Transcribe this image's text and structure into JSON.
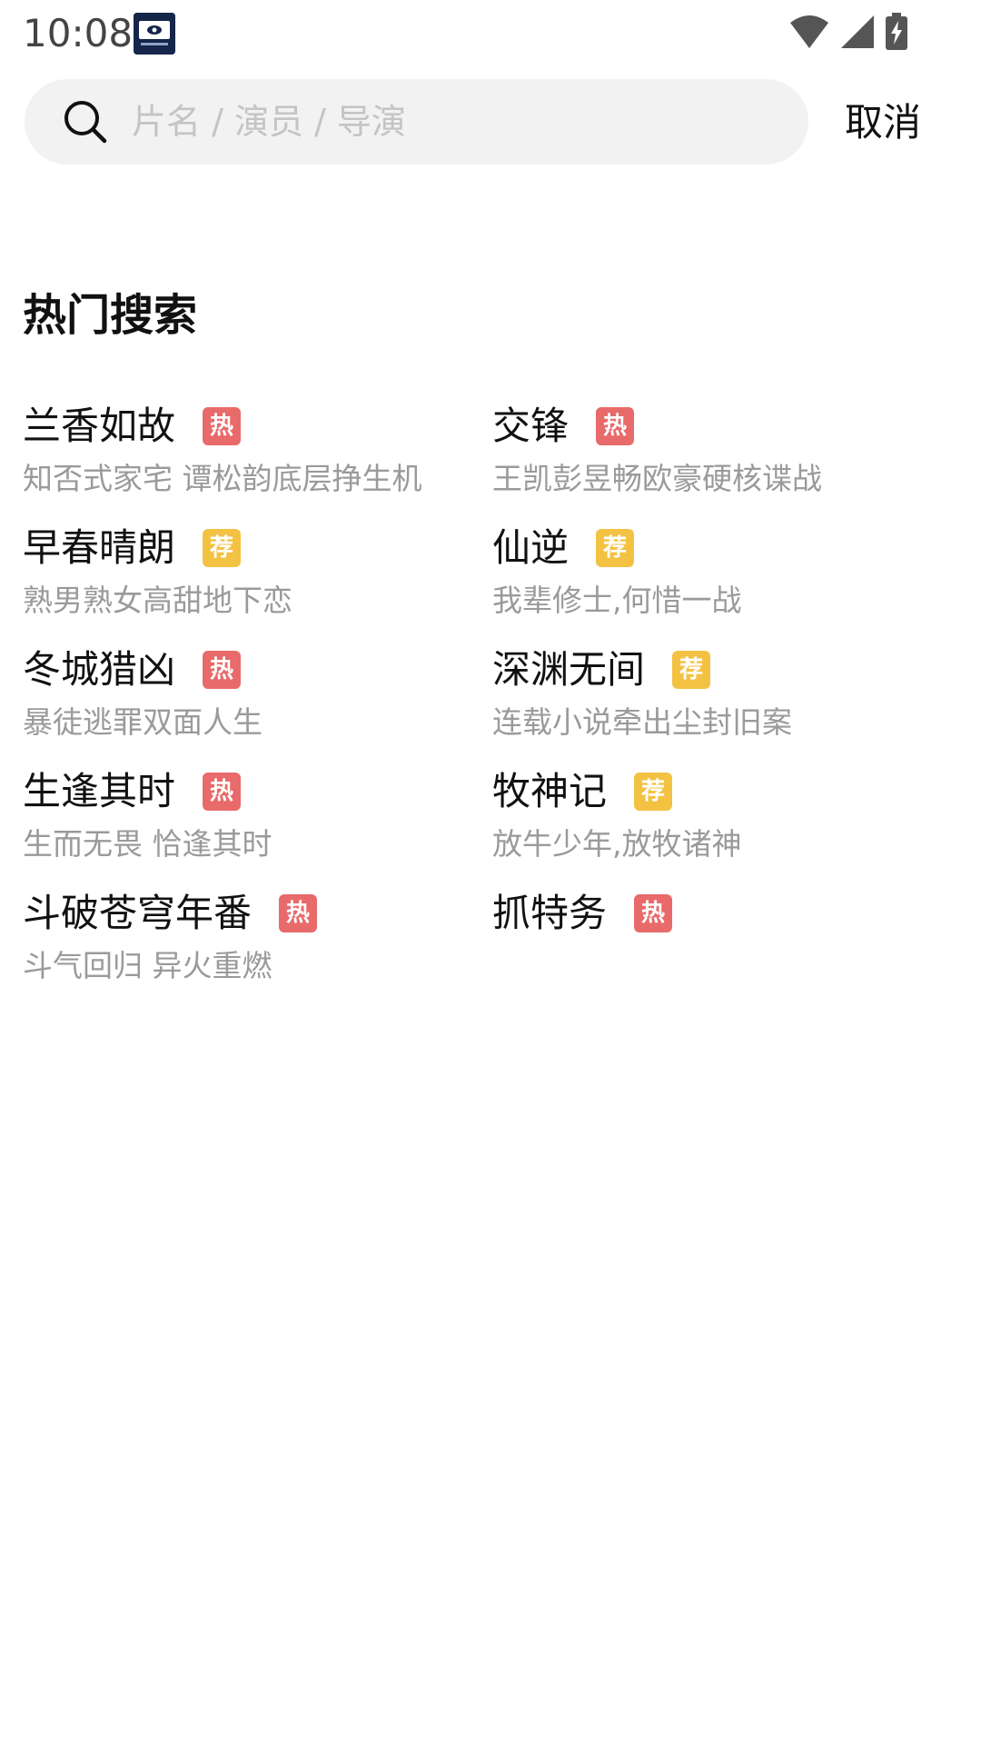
{
  "status_bar": {
    "time": "10:08",
    "app_icon": "tv-app-icon",
    "icons": [
      "wifi-icon",
      "cellular-signal-icon",
      "battery-charging-icon"
    ]
  },
  "search": {
    "placeholder": "片名 / 演员 / 导演",
    "value": "",
    "icon": "search-icon",
    "cancel_label": "取消"
  },
  "hot_search": {
    "title": "热门搜索",
    "badge_colors": {
      "hot": "#e96a6a",
      "recommend": "#f3c243"
    },
    "items": [
      {
        "title": "兰香如故",
        "badge": "热",
        "badge_type": "hot",
        "desc": "知否式家宅 谭松韵底层挣生机"
      },
      {
        "title": "交锋",
        "badge": "热",
        "badge_type": "hot",
        "desc": "王凯彭昱畅欧豪硬核谍战"
      },
      {
        "title": "早春晴朗",
        "badge": "荐",
        "badge_type": "recommend",
        "desc": "熟男熟女高甜地下恋"
      },
      {
        "title": "仙逆",
        "badge": "荐",
        "badge_type": "recommend",
        "desc": "我辈修士,何惜一战"
      },
      {
        "title": "冬城猎凶",
        "badge": "热",
        "badge_type": "hot",
        "desc": "暴徒逃罪双面人生"
      },
      {
        "title": "深渊无间",
        "badge": "荐",
        "badge_type": "recommend",
        "desc": "连载小说牵出尘封旧案"
      },
      {
        "title": "生逢其时",
        "badge": "热",
        "badge_type": "hot",
        "desc": "生而无畏 恰逢其时"
      },
      {
        "title": "牧神记",
        "badge": "荐",
        "badge_type": "recommend",
        "desc": "放牛少年,放牧诸神"
      },
      {
        "title": "斗破苍穹年番",
        "badge": "热",
        "badge_type": "hot",
        "desc": "斗气回归 异火重燃"
      },
      {
        "title": "抓特务",
        "badge": "热",
        "badge_type": "hot",
        "desc": ""
      }
    ]
  }
}
